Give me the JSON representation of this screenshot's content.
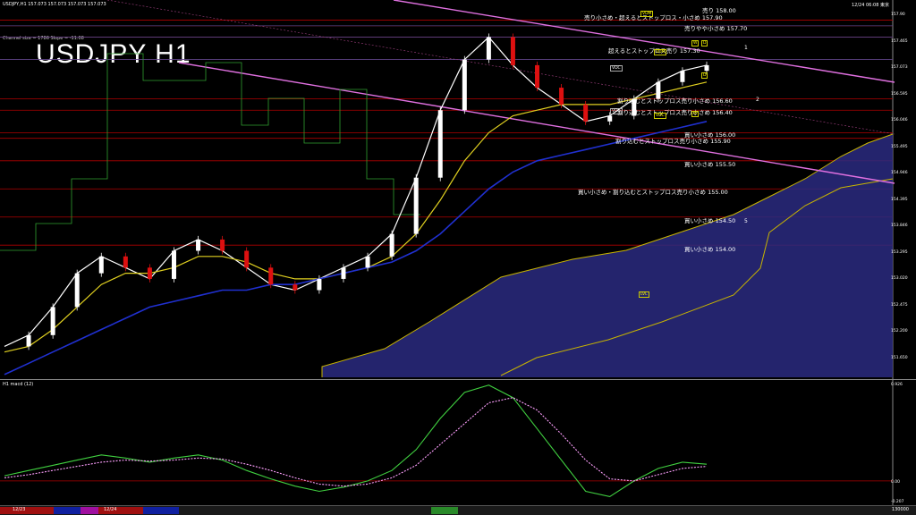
{
  "header": {
    "symbol_line": "USDJPY,H1  157.073 157.073 157.073 157.073",
    "channel_info": "Channel size = 1786 Slope = -11.08",
    "datetime": "12/24 06:08 東京",
    "big_title": "USDJPY H1",
    "macd_label": "H1  macd (12)"
  },
  "price_axis_labels": [
    "157.90",
    "157.465",
    "157.073",
    "156.595",
    "156.046",
    "155.495",
    "154.946",
    "154.395",
    "153.846",
    "153.295",
    "153.020",
    "152.475",
    "152.200",
    "151.650"
  ],
  "macd_axis_labels": [
    "0.926",
    "0.00",
    "-0.207"
  ],
  "levels": [
    {
      "text": "売り 158.00"
    },
    {
      "text": "売り小さめ・超えるとストップロス・小さめ 157.90"
    },
    {
      "text": "売りやや小さめ 157.70"
    },
    {
      "text": "超えるとストップロス売り 157.30"
    },
    {
      "text": "割り込むとストップロス売り小さめ 156.60"
    },
    {
      "text": "割り込むとストップロス売り小さめ 156.40"
    },
    {
      "text": "買い小さめ 156.00"
    },
    {
      "text": "割り込むとストップロス売り小さめ 155.90"
    },
    {
      "text": "買い小さめ 155.50"
    },
    {
      "text": "買い小さめ・割り込むとストップロス売り小さめ 155.00"
    },
    {
      "text": "買い小さめ 154.50"
    },
    {
      "text": "買い小さめ 154.00"
    }
  ],
  "markers": {
    "vdc": "VDC",
    "vdm": "VDM",
    "lvl": "LVL",
    "w": "W",
    "d": "D",
    "n1": "1",
    "n2": "2",
    "n5": "5"
  },
  "statusbar": {
    "date1": "12/23",
    "date2": "12/24",
    "right_label": "130000"
  },
  "colors": {
    "background": "#000000",
    "level_line": "#b00000",
    "channel": "#e070e0",
    "ma_fast": "#ffffff",
    "ma_mid": "#e0d020",
    "ma_slow": "#2030d0",
    "candle_up": "#ffffff",
    "candle_down": "#dd1010",
    "kumo": "#2a2a80",
    "macd_line": "#40d040",
    "signal_line": "#ffa0ff"
  },
  "chart_data": {
    "type": "line",
    "title": "USDJPY H1",
    "ylim": [
      151.65,
      158.2
    ],
    "series": [
      {
        "values": [
          152.2,
          152.4,
          152.9,
          153.5,
          153.8,
          153.6,
          153.4,
          153.9,
          154.1,
          153.9,
          153.6,
          153.3,
          153.2,
          153.4,
          153.6,
          153.8,
          154.2,
          155.2,
          156.4,
          157.3,
          157.7,
          157.2,
          156.8,
          156.5,
          156.2,
          156.3,
          156.6,
          156.9,
          157.1,
          157.2
        ]
      },
      {
        "values": [
          152.1,
          152.2,
          152.5,
          152.9,
          153.3,
          153.5,
          153.5,
          153.6,
          153.8,
          153.8,
          153.7,
          153.5,
          153.4,
          153.4,
          153.5,
          153.6,
          153.8,
          154.2,
          154.8,
          155.5,
          156.0,
          156.3,
          156.4,
          156.5,
          156.5,
          156.5,
          156.6,
          156.7,
          156.8,
          156.9
        ]
      },
      {
        "values": [
          151.7,
          151.9,
          152.1,
          152.3,
          152.5,
          152.7,
          152.9,
          153.0,
          153.1,
          153.2,
          153.2,
          153.3,
          153.3,
          153.4,
          153.5,
          153.6,
          153.7,
          153.9,
          154.2,
          154.6,
          155.0,
          155.3,
          155.5,
          155.6,
          155.7,
          155.8,
          155.9,
          156.0,
          156.1,
          156.2
        ]
      }
    ],
    "macd_series": [
      {
        "values": [
          0.05,
          0.1,
          0.15,
          0.2,
          0.25,
          0.22,
          0.18,
          0.22,
          0.25,
          0.2,
          0.1,
          0.02,
          -0.05,
          -0.1,
          -0.06,
          0.0,
          0.1,
          0.3,
          0.6,
          0.85,
          0.92,
          0.8,
          0.5,
          0.2,
          -0.1,
          -0.15,
          0.0,
          0.12,
          0.18,
          0.16
        ]
      },
      {
        "values": [
          0.03,
          0.06,
          0.1,
          0.14,
          0.18,
          0.2,
          0.19,
          0.2,
          0.22,
          0.21,
          0.16,
          0.1,
          0.03,
          -0.03,
          -0.05,
          -0.03,
          0.03,
          0.15,
          0.35,
          0.55,
          0.75,
          0.8,
          0.68,
          0.45,
          0.2,
          0.02,
          0.0,
          0.06,
          0.12,
          0.14
        ]
      }
    ],
    "grid": false
  }
}
